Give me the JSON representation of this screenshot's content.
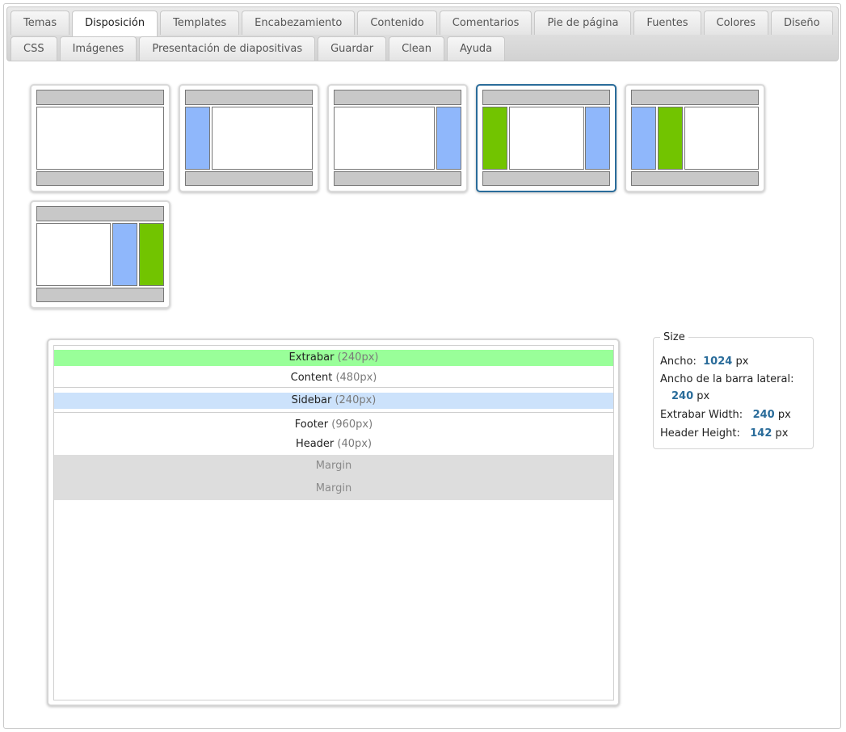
{
  "tabs_row1": [
    "Temas",
    "Disposición",
    "Templates",
    "Encabezamiento",
    "Contenido",
    "Comentarios",
    "Pie de página",
    "Fuentes",
    "Colores",
    "Diseño"
  ],
  "tabs_row2": [
    "CSS",
    "Imágenes",
    "Presentación de diapositivas",
    "Guardar",
    "Clean",
    "Ayuda"
  ],
  "active_tab": "Disposición",
  "selected_layout": "left-extrabar-right-sidebar",
  "layouts": [
    "content-only",
    "left-sidebar",
    "right-sidebar",
    "left-extrabar-right-sidebar",
    "left-sidebar-extrabar",
    "right-sidebar-extrabar"
  ],
  "colors": {
    "extrabar": "#72c400",
    "sidebar": "#8fb7fb",
    "bar": "#c8c8c8",
    "selected_border": "#2a6c9a",
    "extrabar_row": "#99ff99",
    "sidebar_row": "#cce2fb",
    "margin_row": "#dddddd"
  },
  "preview": {
    "extrabar": {
      "label": "Extrabar",
      "size": "(240px)"
    },
    "content": {
      "label": "Content",
      "size": "(480px)"
    },
    "sidebar": {
      "label": "Sidebar",
      "size": "(240px)"
    },
    "footer": {
      "label": "Footer",
      "size": "(960px)"
    },
    "header": {
      "label": "Header",
      "size": "(40px)"
    },
    "margin_top": "Margin",
    "margin_bottom": "Margin"
  },
  "size": {
    "legend": "Size",
    "ancho_label": "Ancho:",
    "ancho_value": "1024",
    "ancho_unit": "px",
    "sidebar_label": "Ancho de la barra lateral:",
    "sidebar_value": "240",
    "sidebar_unit": "px",
    "extrabar_label": "Extrabar Width:",
    "extrabar_value": "240",
    "extrabar_unit": "px",
    "header_label": "Header Height:",
    "header_value": "142",
    "header_unit": "px"
  }
}
